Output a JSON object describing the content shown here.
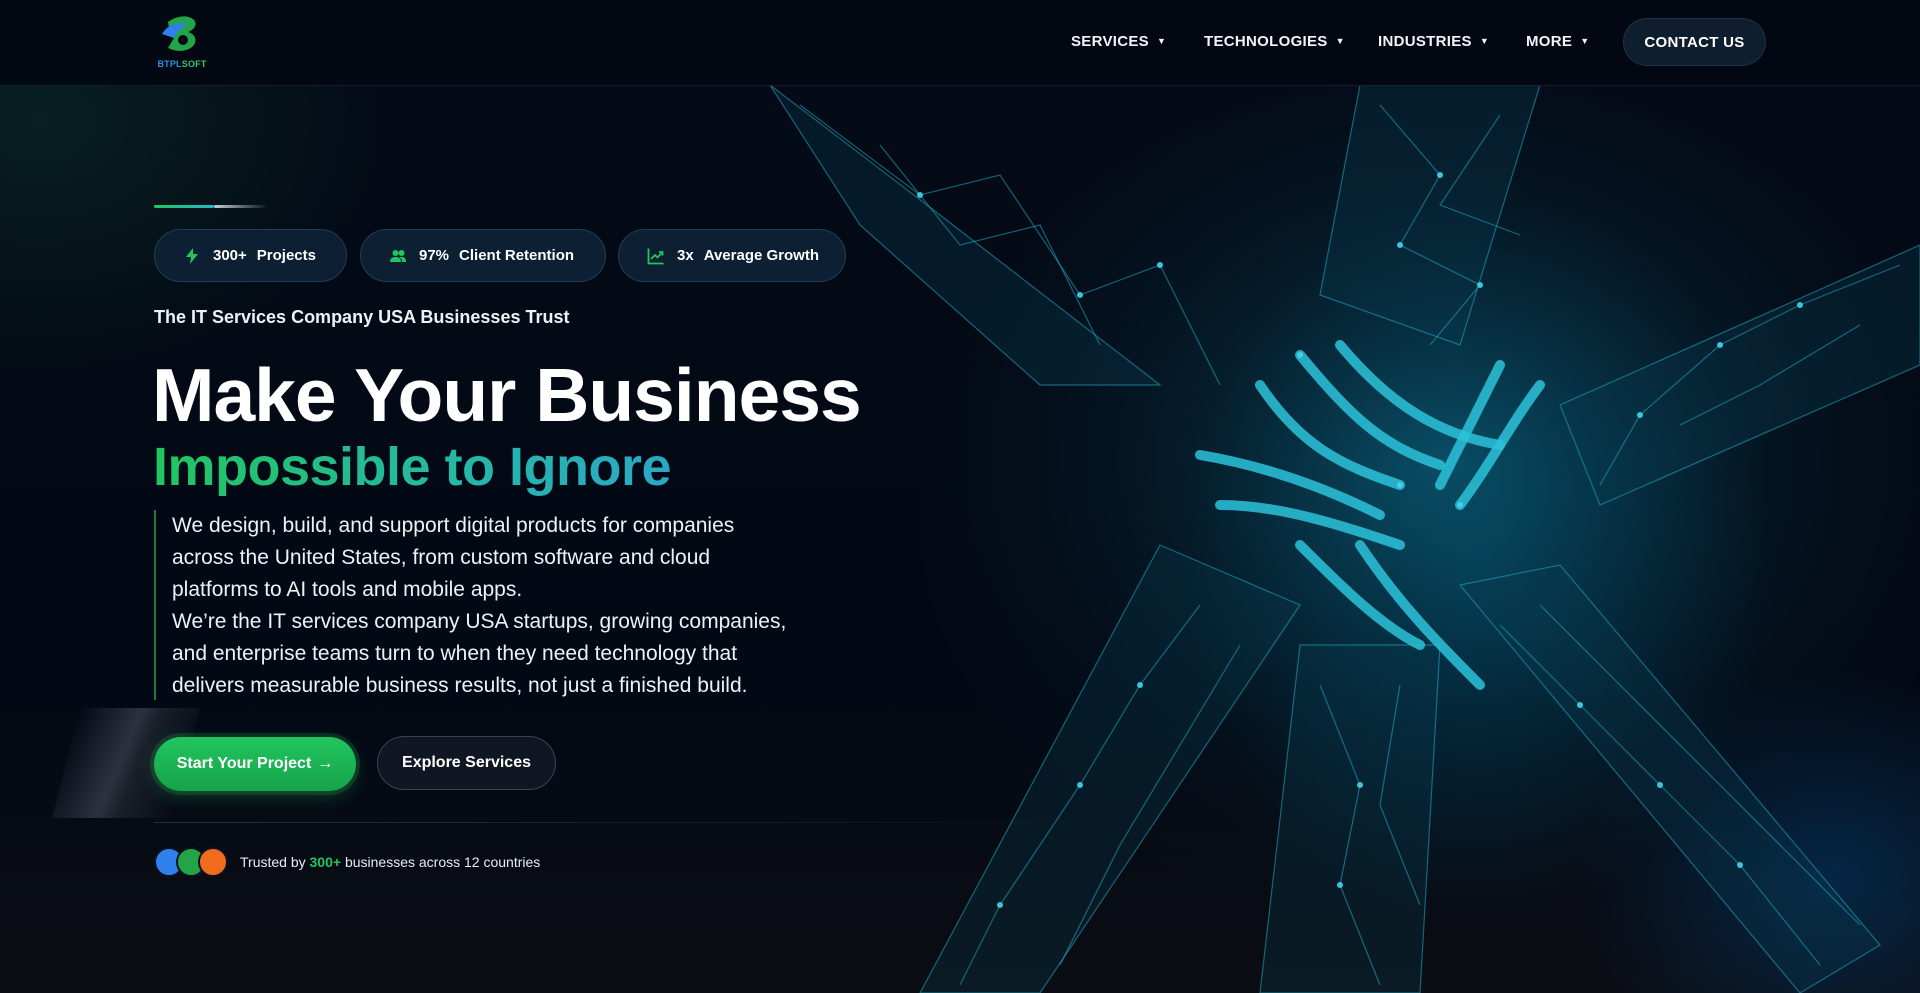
{
  "brand": {
    "logo_text_a": "BTPL",
    "logo_text_b": "SOFT"
  },
  "nav": {
    "items": [
      {
        "label": "SERVICES"
      },
      {
        "label": "TECHNOLOGIES"
      },
      {
        "label": "INDUSTRIES"
      },
      {
        "label": "MORE"
      }
    ],
    "caret": "▼",
    "contact_label": "CONTACT US"
  },
  "stats": [
    {
      "icon": "lightning-icon",
      "number": "300+",
      "label": "Projects"
    },
    {
      "icon": "users-icon",
      "number": "97%",
      "label": "Client Retention"
    },
    {
      "icon": "trend-up-icon",
      "number": "3x",
      "label": "Average Growth"
    }
  ],
  "hero": {
    "tagline": "The IT Services Company USA Businesses Trust",
    "headline_line1": "Make Your Business",
    "headline_line2": "Impossible to Ignore",
    "paragraph_1": "We design, build, and support digital products for companies across the United States, from custom software and cloud platforms to AI tools and mobile apps.",
    "paragraph_2": "We’re the IT services company USA startups, growing companies, and enterprise teams turn to when they need technology that delivers measurable business results, not just a finished build.",
    "primary_cta": "Start Your Project",
    "primary_cta_arrow": "→",
    "secondary_cta": "Explore Services"
  },
  "trust": {
    "prefix": "Trusted by",
    "count": "300+",
    "suffix": "businesses across 12 countries",
    "avatar_colors": [
      "#2f80ed",
      "#22a447",
      "#f26b1d"
    ]
  },
  "colors": {
    "accent_green": "#22c55e",
    "accent_teal": "#2aa8c6",
    "background": "#030914"
  }
}
